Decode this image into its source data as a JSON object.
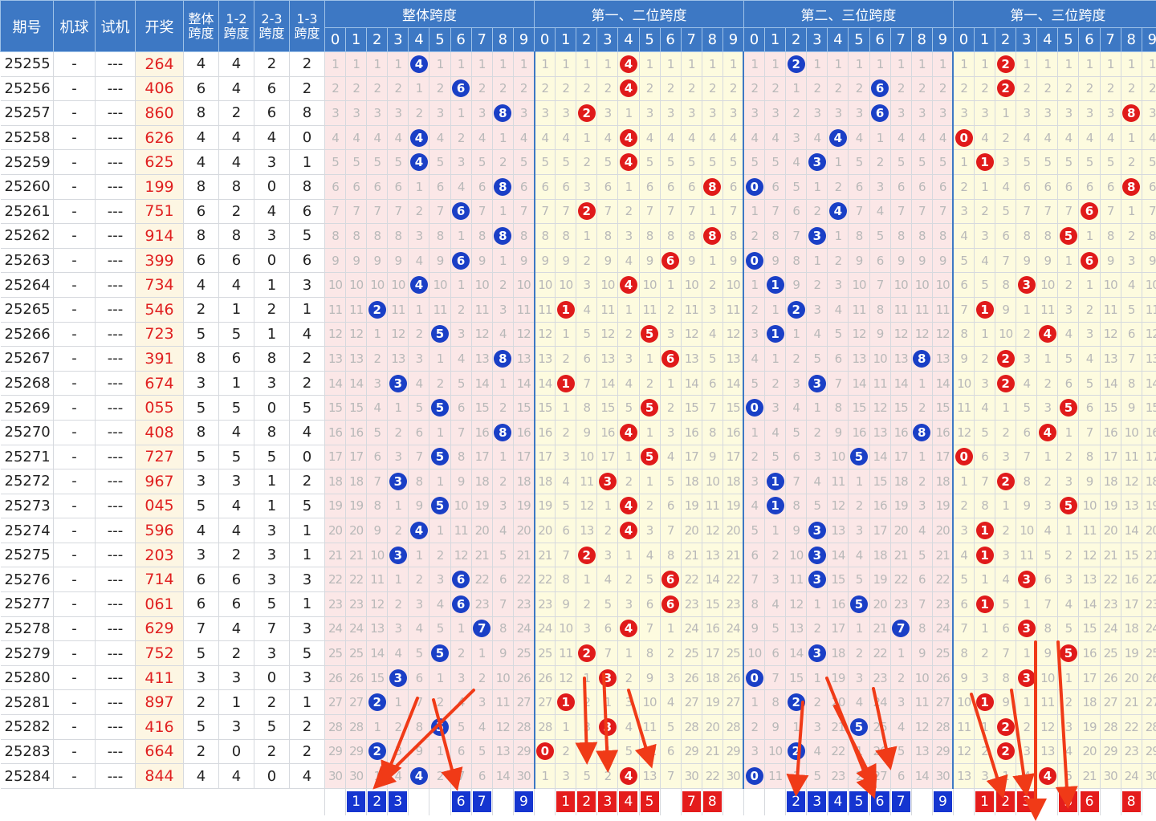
{
  "header": {
    "issue_label": "期号",
    "machine_label": "机球",
    "test_label": "试机",
    "draw_label": "开奖",
    "span_labels": [
      [
        "整体",
        "跨度"
      ],
      [
        "1-2",
        "跨度"
      ],
      [
        "2-3",
        "跨度"
      ],
      [
        "1-3",
        "跨度"
      ]
    ],
    "groups": [
      "整体跨度",
      "第一、二位跨度",
      "第二、三位跨度",
      "第一、三位跨度"
    ],
    "digits": [
      "0",
      "1",
      "2",
      "3",
      "4",
      "5",
      "6",
      "7",
      "8",
      "9"
    ]
  },
  "draws": [
    {
      "issue": "25255",
      "machine": "-",
      "test": "---",
      "num": "264"
    },
    {
      "issue": "25256",
      "machine": "-",
      "test": "---",
      "num": "406"
    },
    {
      "issue": "25257",
      "machine": "-",
      "test": "---",
      "num": "860"
    },
    {
      "issue": "25258",
      "machine": "-",
      "test": "---",
      "num": "626"
    },
    {
      "issue": "25259",
      "machine": "-",
      "test": "---",
      "num": "625"
    },
    {
      "issue": "25260",
      "machine": "-",
      "test": "---",
      "num": "199"
    },
    {
      "issue": "25261",
      "machine": "-",
      "test": "---",
      "num": "751"
    },
    {
      "issue": "25262",
      "machine": "-",
      "test": "---",
      "num": "914"
    },
    {
      "issue": "25263",
      "machine": "-",
      "test": "---",
      "num": "399"
    },
    {
      "issue": "25264",
      "machine": "-",
      "test": "---",
      "num": "734"
    },
    {
      "issue": "25265",
      "machine": "-",
      "test": "---",
      "num": "546"
    },
    {
      "issue": "25266",
      "machine": "-",
      "test": "---",
      "num": "723"
    },
    {
      "issue": "25267",
      "machine": "-",
      "test": "---",
      "num": "391"
    },
    {
      "issue": "25268",
      "machine": "-",
      "test": "---",
      "num": "674"
    },
    {
      "issue": "25269",
      "machine": "-",
      "test": "---",
      "num": "055"
    },
    {
      "issue": "25270",
      "machine": "-",
      "test": "---",
      "num": "408"
    },
    {
      "issue": "25271",
      "machine": "-",
      "test": "---",
      "num": "727"
    },
    {
      "issue": "25272",
      "machine": "-",
      "test": "---",
      "num": "967"
    },
    {
      "issue": "25273",
      "machine": "-",
      "test": "---",
      "num": "045"
    },
    {
      "issue": "25274",
      "machine": "-",
      "test": "---",
      "num": "596"
    },
    {
      "issue": "25275",
      "machine": "-",
      "test": "---",
      "num": "203"
    },
    {
      "issue": "25276",
      "machine": "-",
      "test": "---",
      "num": "714"
    },
    {
      "issue": "25277",
      "machine": "-",
      "test": "---",
      "num": "061"
    },
    {
      "issue": "25278",
      "machine": "-",
      "test": "---",
      "num": "629"
    },
    {
      "issue": "25279",
      "machine": "-",
      "test": "---",
      "num": "752"
    },
    {
      "issue": "25280",
      "machine": "-",
      "test": "---",
      "num": "411"
    },
    {
      "issue": "25281",
      "machine": "-",
      "test": "---",
      "num": "897"
    },
    {
      "issue": "25282",
      "machine": "-",
      "test": "---",
      "num": "416"
    },
    {
      "issue": "25283",
      "machine": "-",
      "test": "---",
      "num": "664"
    },
    {
      "issue": "25284",
      "machine": "-",
      "test": "---",
      "num": "844"
    }
  ],
  "predictions": [
    [
      "1",
      "2",
      "3",
      "6",
      "7",
      "9"
    ],
    [
      "1",
      "2",
      "3",
      "4",
      "5",
      "7",
      "8"
    ],
    [
      "2",
      "3",
      "4",
      "5",
      "6",
      "7",
      "9"
    ],
    [
      "1",
      "2",
      "3",
      "5",
      "6",
      "8"
    ]
  ],
  "colors": {
    "header_bg": "#3d78c4",
    "ball_blue": "#1a3fc6",
    "ball_red": "#e01a1a",
    "draw_number": "#e02020",
    "arrow": "#f03a17"
  }
}
